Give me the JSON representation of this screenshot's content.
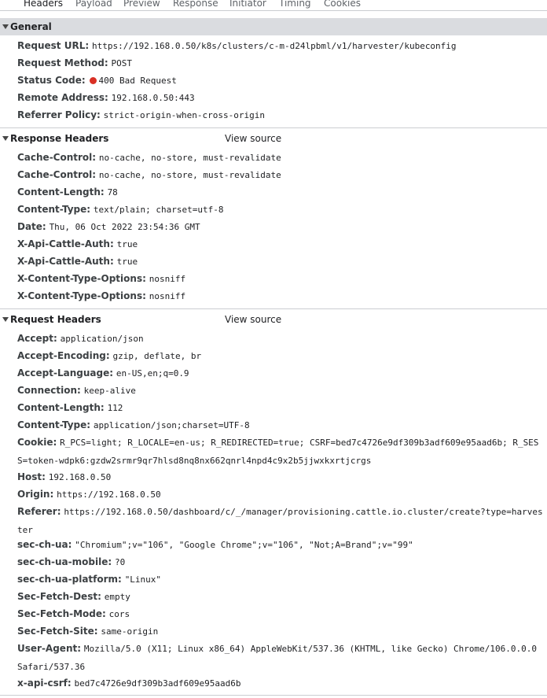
{
  "tabs": [
    "Headers",
    "Payload",
    "Preview",
    "Response",
    "Initiator",
    "Timing",
    "Cookies"
  ],
  "general": {
    "title": "General",
    "rows": [
      {
        "k": "Request URL:",
        "v": "https://192.168.0.50/k8s/clusters/c-m-d24lpbml/v1/harvester/kubeconfig"
      },
      {
        "k": "Request Method:",
        "v": "POST"
      },
      {
        "k": "Status Code:",
        "v": "400 Bad Request"
      },
      {
        "k": "Remote Address:",
        "v": "192.168.0.50:443"
      },
      {
        "k": "Referrer Policy:",
        "v": "strict-origin-when-cross-origin"
      }
    ]
  },
  "response_headers": {
    "title": "Response Headers",
    "view_source": "View source",
    "rows": [
      {
        "k": "Cache-Control:",
        "v": "no-cache, no-store, must-revalidate"
      },
      {
        "k": "Cache-Control:",
        "v": "no-cache, no-store, must-revalidate"
      },
      {
        "k": "Content-Length:",
        "v": "78"
      },
      {
        "k": "Content-Type:",
        "v": "text/plain; charset=utf-8"
      },
      {
        "k": "Date:",
        "v": "Thu, 06 Oct 2022 23:54:36 GMT"
      },
      {
        "k": "X-Api-Cattle-Auth:",
        "v": "true"
      },
      {
        "k": "X-Api-Cattle-Auth:",
        "v": "true"
      },
      {
        "k": "X-Content-Type-Options:",
        "v": "nosniff"
      },
      {
        "k": "X-Content-Type-Options:",
        "v": "nosniff"
      }
    ]
  },
  "request_headers": {
    "title": "Request Headers",
    "view_source": "View source",
    "rows": [
      {
        "k": "Accept:",
        "v": "application/json"
      },
      {
        "k": "Accept-Encoding:",
        "v": "gzip, deflate, br"
      },
      {
        "k": "Accept-Language:",
        "v": "en-US,en;q=0.9"
      },
      {
        "k": "Connection:",
        "v": "keep-alive"
      },
      {
        "k": "Content-Length:",
        "v": "112"
      },
      {
        "k": "Content-Type:",
        "v": "application/json;charset=UTF-8"
      },
      {
        "k": "Cookie:",
        "v": "R_PCS=light; R_LOCALE=en-us; R_REDIRECTED=true; CSRF=bed7c4726e9df309b3adf609e95aad6b; R_SESS=token-wdpk6:gzdw2srmr9qr7hlsd8nq8nx662qnrl4npd4c9x2b5jjwxkxrtjcrgs"
      },
      {
        "k": "Host:",
        "v": "192.168.0.50"
      },
      {
        "k": "Origin:",
        "v": "https://192.168.0.50"
      },
      {
        "k": "Referer:",
        "v": "https://192.168.0.50/dashboard/c/_/manager/provisioning.cattle.io.cluster/create?type=harvester"
      },
      {
        "k": "sec-ch-ua:",
        "v": "\"Chromium\";v=\"106\", \"Google Chrome\";v=\"106\", \"Not;A=Brand\";v=\"99\""
      },
      {
        "k": "sec-ch-ua-mobile:",
        "v": "?0"
      },
      {
        "k": "sec-ch-ua-platform:",
        "v": "\"Linux\""
      },
      {
        "k": "Sec-Fetch-Dest:",
        "v": "empty"
      },
      {
        "k": "Sec-Fetch-Mode:",
        "v": "cors"
      },
      {
        "k": "Sec-Fetch-Site:",
        "v": "same-origin"
      },
      {
        "k": "User-Agent:",
        "v": "Mozilla/5.0 (X11; Linux x86_64) AppleWebKit/537.36 (KHTML, like Gecko) Chrome/106.0.0.0 Safari/537.36"
      },
      {
        "k": "x-api-csrf:",
        "v": "bed7c4726e9df309b3adf609e95aad6b"
      }
    ]
  },
  "colors": {
    "status_error": "#d93025",
    "active_tab": "#1a73e8",
    "section_bg": "#dadce0"
  },
  "icons": {
    "section_toggle": "triangle-down-icon",
    "status": "red-dot-icon"
  }
}
